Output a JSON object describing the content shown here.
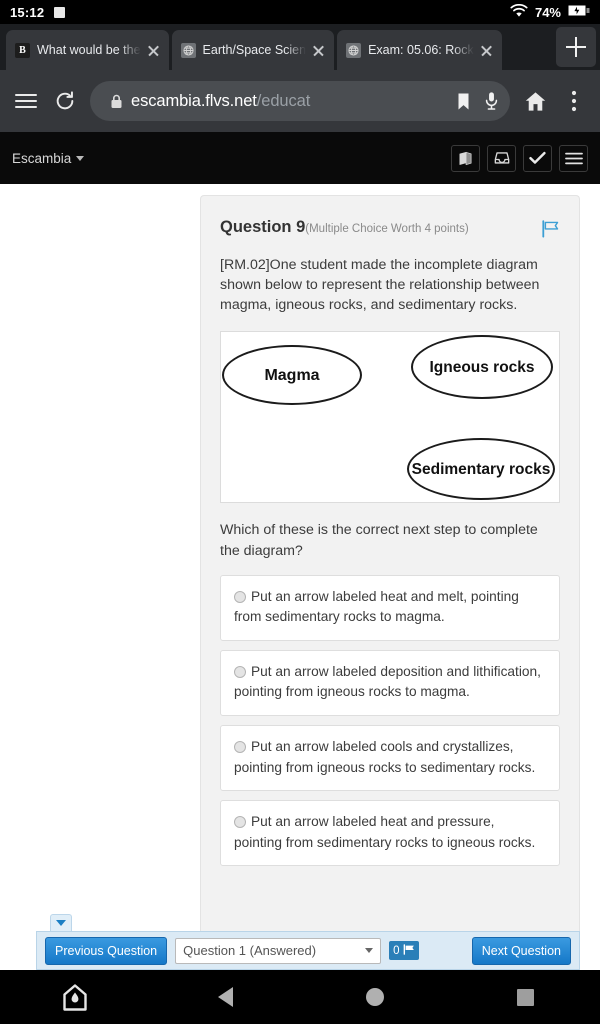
{
  "status_bar": {
    "time": "15:12",
    "battery_percent": "74%",
    "icons": [
      "stop-recording-icon",
      "wifi-icon",
      "battery-charging-icon"
    ]
  },
  "browser": {
    "tabs": [
      {
        "title": "What would be the",
        "favicon": "brainly-icon",
        "favicon_letter": "B"
      },
      {
        "title": "Earth/Space Scien",
        "favicon": "globe-icon"
      },
      {
        "title": "Exam: 05.06: Rock",
        "favicon": "globe-icon"
      }
    ],
    "new_tab_label": "+",
    "toolbar": {
      "menu_icon": "hamburger-menu-icon",
      "reload_icon": "reload-icon",
      "lock_icon": "lock-icon",
      "url_domain": "escambia.flvs.net",
      "url_path": "/educat",
      "bookmark_icon": "bookmark-icon",
      "mic_icon": "microphone-icon",
      "home_icon": "home-icon",
      "overflow_icon": "more-vertical-icon"
    }
  },
  "page_header": {
    "brand": "Escambia",
    "tools": [
      "course-book-icon",
      "inbox-icon",
      "check-icon",
      "menu-icon"
    ]
  },
  "question": {
    "number_label": "Question 9",
    "meta": "(Multiple Choice Worth 4 points)",
    "flag_icon": "flag-icon",
    "stem": "[RM.02]One student made the incomplete diagram shown below to represent the relationship between magma, igneous rocks, and sedimentary rocks.",
    "diagram": {
      "nodes": [
        {
          "id": "magma",
          "label": "Magma"
        },
        {
          "id": "igneous",
          "label": "Igneous rocks"
        },
        {
          "id": "sedimentary",
          "label": "Sedimentary rocks"
        }
      ]
    },
    "prompt": "Which of these is the correct next step to complete the diagram?",
    "options": [
      {
        "id": "a",
        "text": "Put an arrow labeled heat and melt, pointing from sedimentary rocks to magma.",
        "selected": false
      },
      {
        "id": "b",
        "text": "Put an arrow labeled deposition and lithification, pointing from igneous rocks to magma.",
        "selected": false
      },
      {
        "id": "c",
        "text": "Put an arrow labeled cools and crystallizes, pointing from igneous rocks to sedimentary rocks.",
        "selected": false
      },
      {
        "id": "d",
        "text": "Put an arrow labeled heat and pressure, pointing from sedimentary rocks to igneous rocks.",
        "selected": false
      }
    ]
  },
  "exam_nav": {
    "collapse_icon": "chevron-down-icon",
    "previous_label": "Previous Question",
    "question_select_value": "Question 1 (Answered)",
    "flag_count": "0",
    "flag_badge_icon": "flag-icon",
    "next_label": "Next Question"
  },
  "android_nav": {
    "items": [
      "app-home-icon",
      "back-icon",
      "home-icon",
      "recents-icon"
    ]
  },
  "colors": {
    "accent_blue": "#1578c8",
    "toolbar_dark": "#35373b",
    "page_bg": "#f2f2f2",
    "nav_bar_bg": "#dbeaf5"
  }
}
